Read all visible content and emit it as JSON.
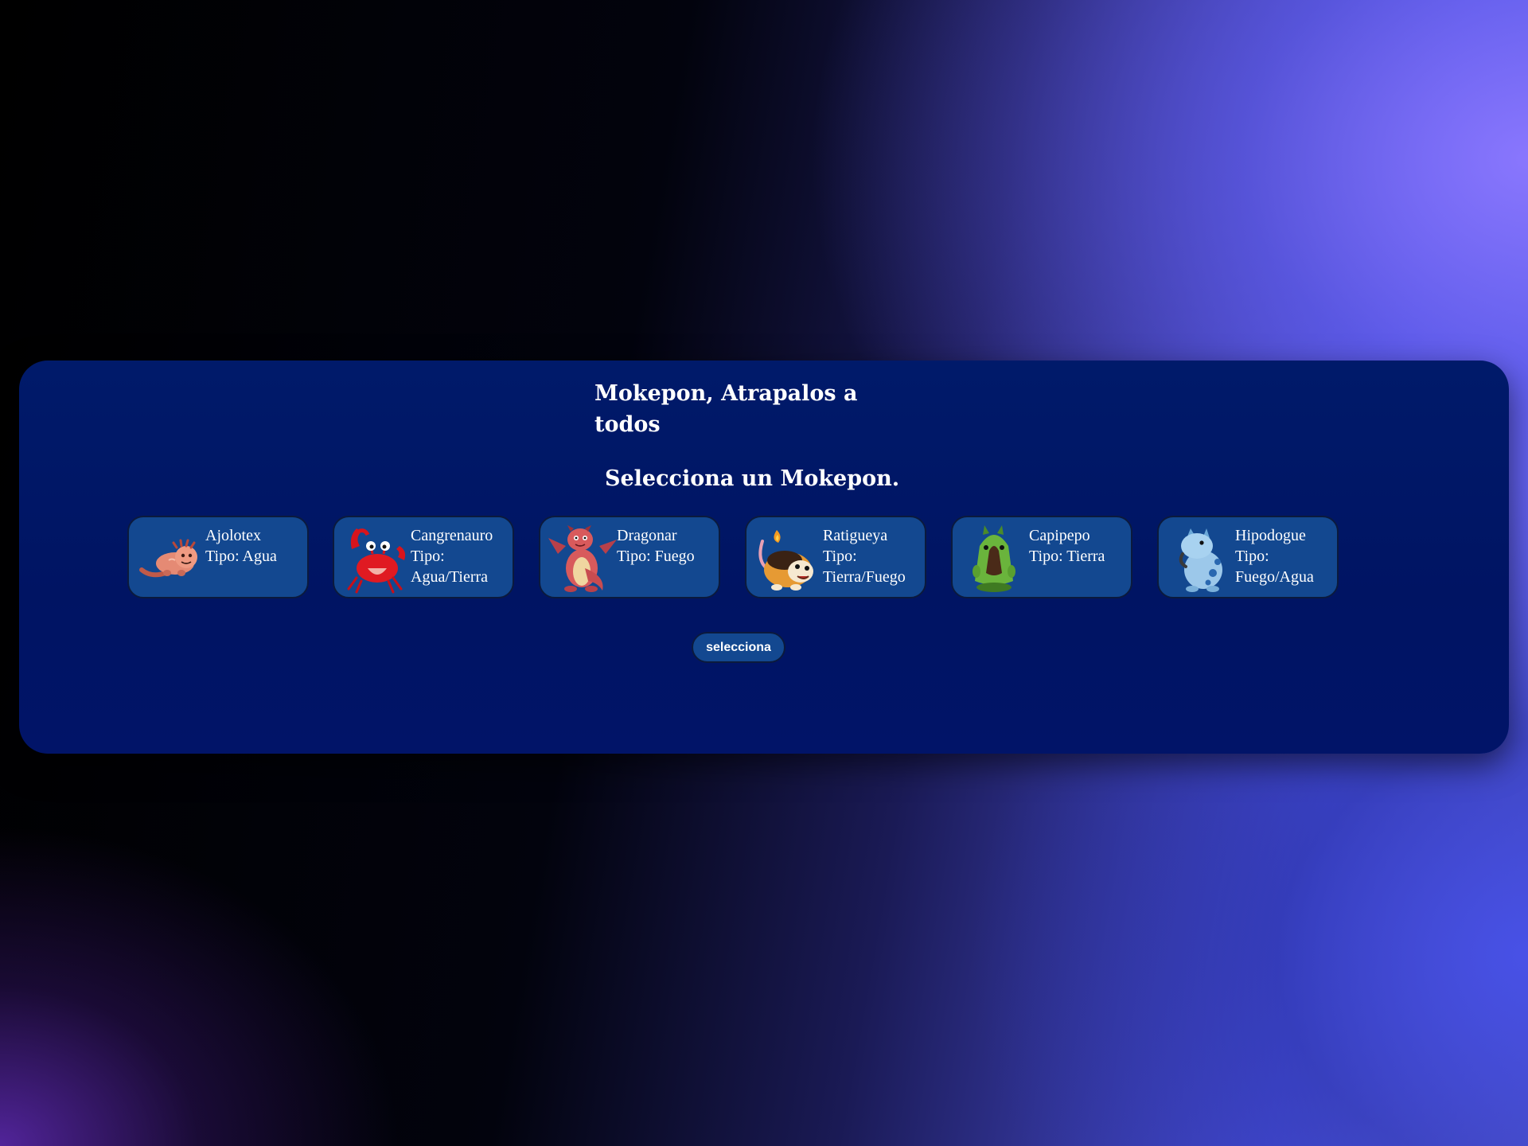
{
  "header": {
    "title": "Mokepon, Atrapalos a todos",
    "subtitle": "Selecciona un Mokepon."
  },
  "mokepones": [
    {
      "name": "Ajolotex",
      "type": "Tipo: Agua",
      "icon": "axolotl-icon"
    },
    {
      "name": "Cangrenauro",
      "type": "Tipo: Agua/Tierra",
      "icon": "crab-icon"
    },
    {
      "name": "Dragonar",
      "type": "Tipo: Fuego",
      "icon": "dragon-icon"
    },
    {
      "name": "Ratigueya",
      "type": "Tipo: Tierra/Fuego",
      "icon": "rat-icon"
    },
    {
      "name": "Capipepo",
      "type": "Tipo: Tierra",
      "icon": "capybara-icon"
    },
    {
      "name": "Hipodogue",
      "type": "Tipo: Fuego/Agua",
      "icon": "hippo-icon"
    }
  ],
  "select_button": {
    "label": "selecciona"
  },
  "colors": {
    "panel": "#001a6a",
    "card": "#134890",
    "card_border": "#0b1a3d",
    "text": "#ffffff"
  }
}
